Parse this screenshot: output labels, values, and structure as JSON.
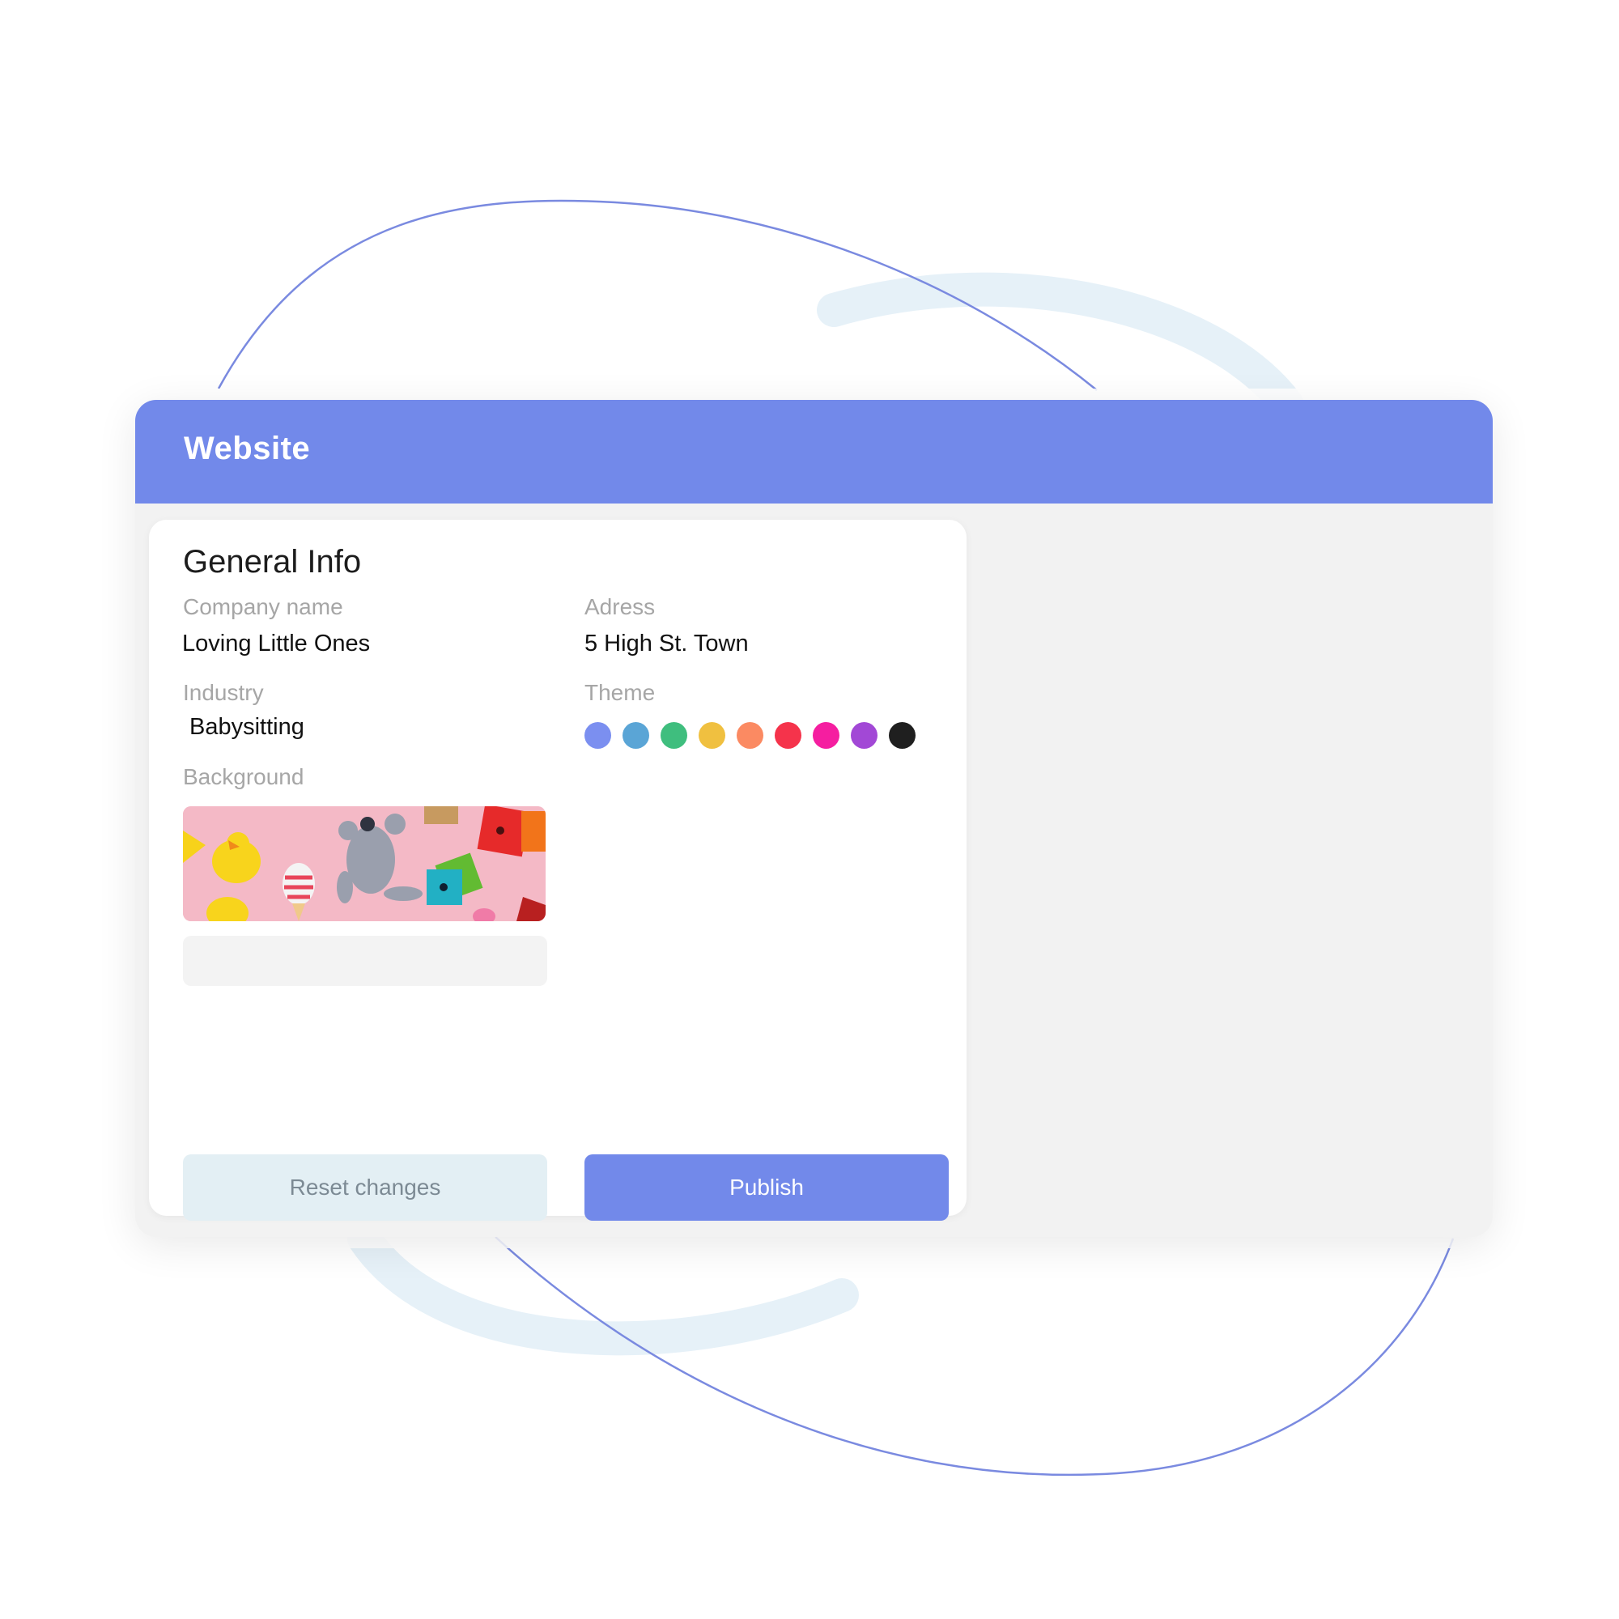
{
  "window": {
    "title": "Website"
  },
  "general_info": {
    "heading": "General Info",
    "company_name": {
      "label": "Company name",
      "value": "Loving Little Ones"
    },
    "address": {
      "label": "Adress",
      "value": "5 High St. Town"
    },
    "industry": {
      "label": "Industry",
      "value": "Babysitting"
    },
    "theme": {
      "label": "Theme",
      "colors": [
        "#7b8ff0",
        "#5aa5d6",
        "#3fbe7e",
        "#f0c040",
        "#fb8a62",
        "#f5334b",
        "#f51ea0",
        "#a248d6",
        "#1f1f1f"
      ]
    },
    "background": {
      "label": "Background",
      "image": "toys-on-pink-background"
    }
  },
  "actions": {
    "reset_label": "Reset changes",
    "publish_label": "Publish"
  },
  "colors": {
    "accent": "#7289ea",
    "panel": "#f2f2f2",
    "reset_button": "#e3eff4",
    "decor_line": "#7a8ae0",
    "decor_band": "#e6f1f8"
  }
}
